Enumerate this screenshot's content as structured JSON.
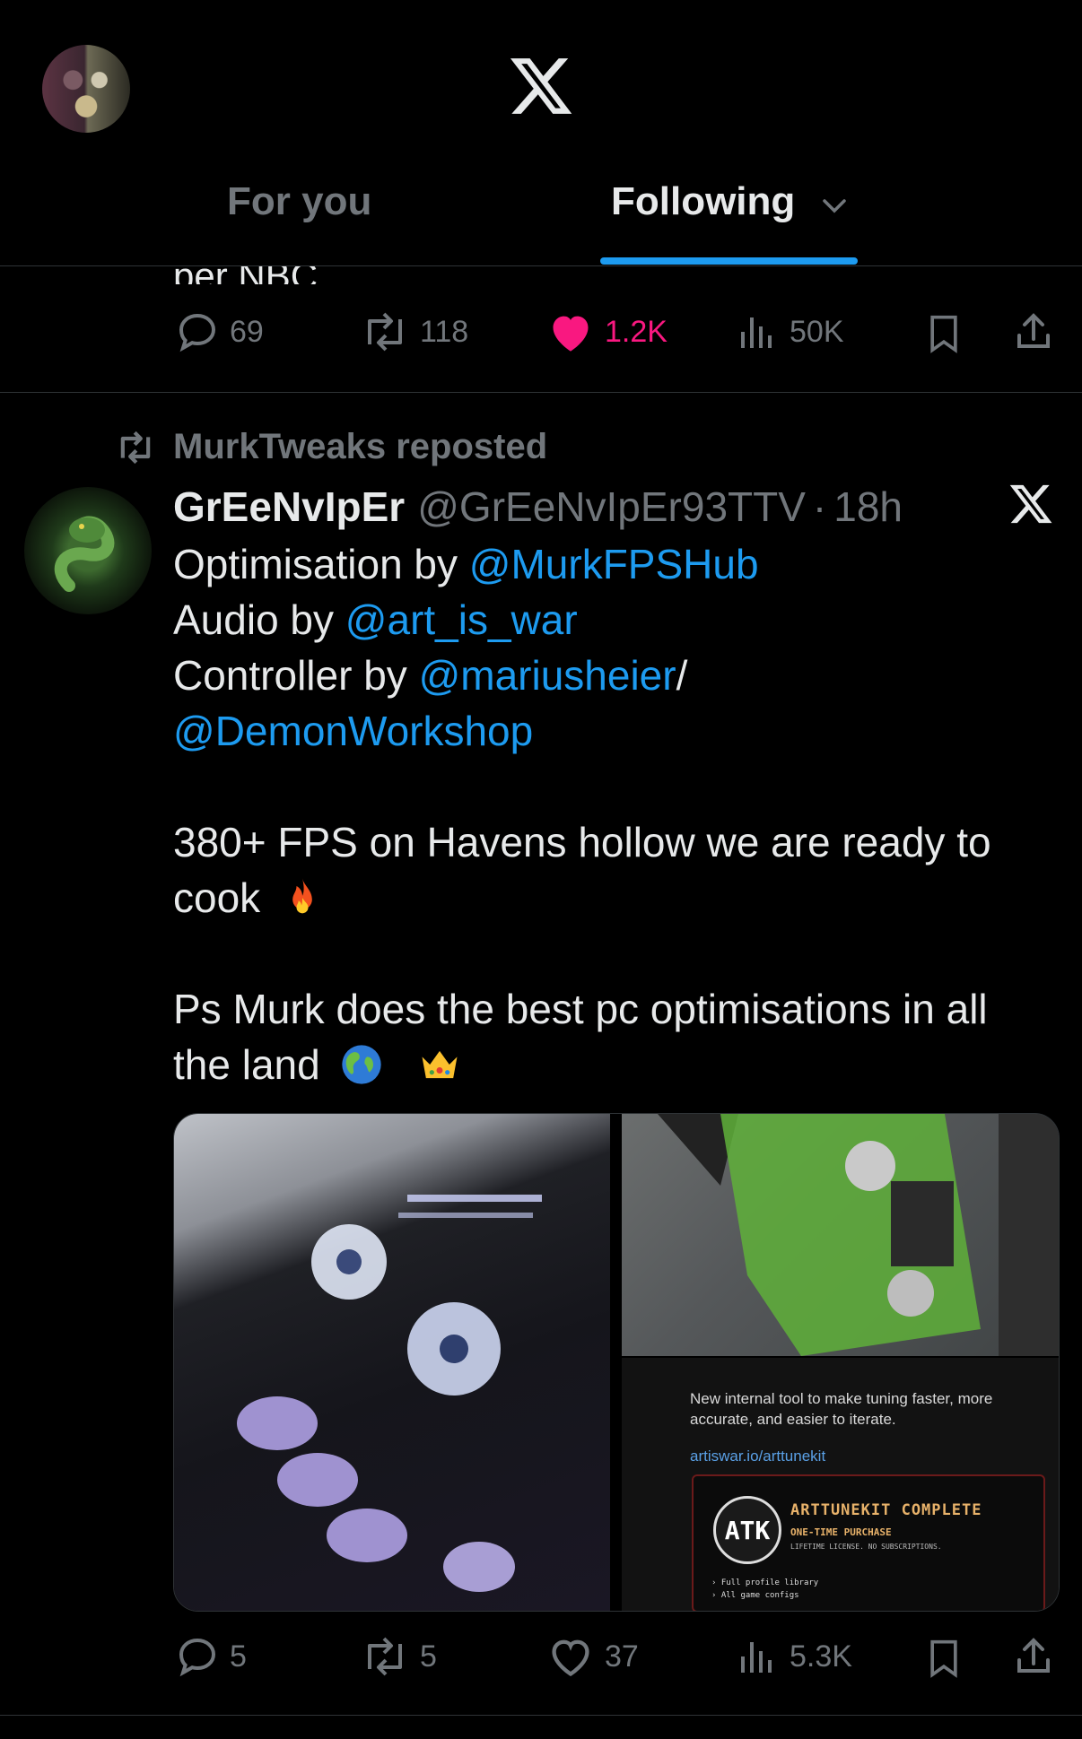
{
  "header": {
    "logo": "x-logo-icon",
    "tabs": [
      {
        "label": "For you"
      },
      {
        "label": "Following"
      }
    ]
  },
  "prev_tweet": {
    "clipped_text": "per NBC",
    "actions": {
      "replies": "69",
      "reposts": "118",
      "likes": "1.2K",
      "views": "50K"
    }
  },
  "tweet": {
    "repost_label": "MurkTweaks reposted",
    "author_name": "GrEeNvIpEr",
    "author_handle": "@GrEeNvIpEr93TTV",
    "separator": "·",
    "time": "18h",
    "lines": {
      "l1_text": "Optimisation by ",
      "l1_mention": "@MurkFPSHub",
      "l2_text": "Audio by ",
      "l2_mention": "@art_is_war",
      "l3_text": "Controller by ",
      "l3_mention": "@mariusheier",
      "l3_tail": "/",
      "l4_mention": "@DemonWorkshop",
      "l5": "380+ FPS on Havens hollow we are ready to",
      "l6": "cook",
      "l7": "Ps Murk does the best pc optimisations in all",
      "l8": "the land"
    },
    "emojis": [
      "fire-emoji",
      "globe-emoji",
      "crown-emoji"
    ],
    "media": {
      "screenshot_text": "New internal tool to make tuning faster, more accurate, and easier to iterate.",
      "screenshot_link": "artiswar.io/arttunekit",
      "card_logo": "ATK",
      "card_title": "ARTTUNEKIT COMPLETE",
      "card_sub": "ONE-TIME PURCHASE",
      "card_sub2": "LIFETIME LICENSE. NO SUBSCRIPTIONS.",
      "card_item1": "› Full profile library",
      "card_item2": "› All game configs"
    },
    "actions": {
      "replies": "5",
      "reposts": "5",
      "likes": "37",
      "views": "5.3K"
    }
  },
  "colors": {
    "accent": "#1d9bf0",
    "like": "#f91880",
    "muted": "#71767b",
    "text": "#e7e9ea",
    "background": "#000000"
  }
}
